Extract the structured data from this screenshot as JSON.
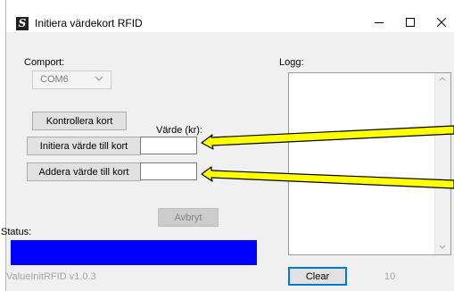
{
  "window": {
    "title": "Initiera värdekort RFID",
    "app_icon_glyph": "S",
    "controls": [
      "minimize-icon",
      "maximize-icon",
      "close-icon"
    ]
  },
  "comport": {
    "label": "Comport:",
    "selected": "COM6"
  },
  "buttons": {
    "check_card": "Kontrollera kort",
    "init_value": "Initiera värde till kort",
    "add_value": "Addera värde till kort",
    "cancel": "Avbryt",
    "clear": "Clear"
  },
  "value_field": {
    "label": "Värde (kr):",
    "init_value": "",
    "add_value": ""
  },
  "log": {
    "label": "Logg:",
    "content": ""
  },
  "status": {
    "label": "Status:",
    "progress": 1.0,
    "progress_color": "#0000ff"
  },
  "footer": {
    "version": "ValueInitRFID v1.0.3",
    "counter": "10"
  },
  "colors": {
    "annotation_arrow_fill": "#ffff00",
    "annotation_arrow_stroke": "#000000",
    "accent": "#0078d7"
  }
}
